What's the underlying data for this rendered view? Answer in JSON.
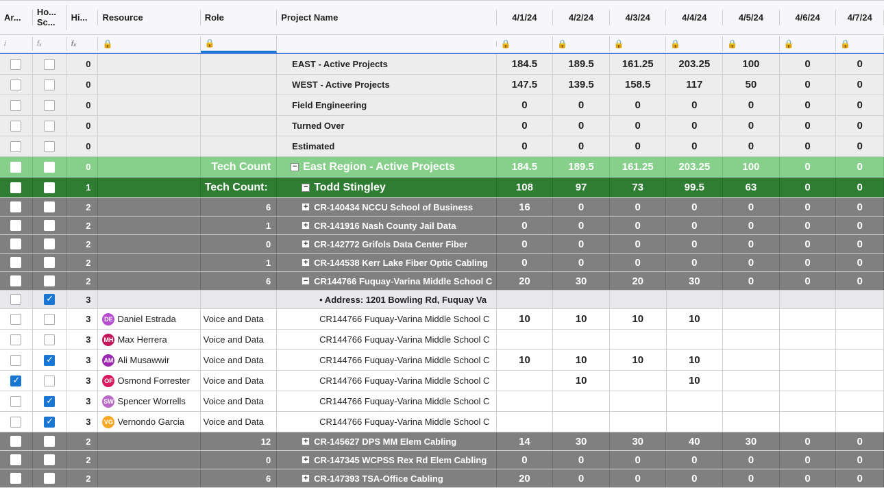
{
  "headers": {
    "ar": "Ar...",
    "ho": "Ho... Sc...",
    "hi": "Hi...",
    "resource": "Resource",
    "role": "Role",
    "project": "Project Name",
    "dates": [
      "4/1/24",
      "4/2/24",
      "4/3/24",
      "4/4/24",
      "4/5/24",
      "4/6/24",
      "4/7/24"
    ]
  },
  "subhdr": {
    "fx": "fₓ",
    "lock": "🔒",
    "i": "i"
  },
  "summary": [
    {
      "hi": "0",
      "name": "EAST - Active Projects",
      "vals": [
        "184.5",
        "189.5",
        "161.25",
        "203.25",
        "100",
        "0",
        "0"
      ]
    },
    {
      "hi": "0",
      "name": "WEST - Active Projects",
      "vals": [
        "147.5",
        "139.5",
        "158.5",
        "117",
        "50",
        "0",
        "0"
      ]
    },
    {
      "hi": "0",
      "name": "Field Engineering",
      "vals": [
        "0",
        "0",
        "0",
        "0",
        "0",
        "0",
        "0"
      ]
    },
    {
      "hi": "0",
      "name": "Turned Over",
      "vals": [
        "0",
        "0",
        "0",
        "0",
        "0",
        "0",
        "0"
      ]
    },
    {
      "hi": "0",
      "name": "Estimated",
      "vals": [
        "0",
        "0",
        "0",
        "0",
        "0",
        "0",
        "0"
      ]
    }
  ],
  "region": {
    "hi": "0",
    "role": "Tech Count",
    "name": "East Region - Active Projects",
    "toggle": "−",
    "vals": [
      "184.5",
      "189.5",
      "161.25",
      "203.25",
      "100",
      "0",
      "0"
    ]
  },
  "leader": {
    "hi": "1",
    "role": "Tech Count:",
    "name": "Todd Stingley",
    "toggle": "−",
    "vals": [
      "108",
      "97",
      "73",
      "99.5",
      "63",
      "0",
      "0"
    ]
  },
  "projectsA": [
    {
      "hi": "2",
      "role": "6",
      "toggle": "+",
      "name": "CR-140434 NCCU School of Business",
      "vals": [
        "16",
        "0",
        "0",
        "0",
        "0",
        "0",
        "0"
      ]
    },
    {
      "hi": "2",
      "role": "1",
      "toggle": "+",
      "name": "CR-141916 Nash County Jail Data",
      "vals": [
        "0",
        "0",
        "0",
        "0",
        "0",
        "0",
        "0"
      ]
    },
    {
      "hi": "2",
      "role": "0",
      "toggle": "+",
      "name": "CR-142772 Grifols Data Center Fiber",
      "vals": [
        "0",
        "0",
        "0",
        "0",
        "0",
        "0",
        "0"
      ]
    },
    {
      "hi": "2",
      "role": "1",
      "toggle": "+",
      "name": "CR-144538 Kerr Lake Fiber Optic Cabling",
      "vals": [
        "0",
        "0",
        "0",
        "0",
        "0",
        "0",
        "0"
      ]
    },
    {
      "hi": "2",
      "role": "6",
      "toggle": "−",
      "name": "CR144766 Fuquay-Varina Middle School C",
      "vals": [
        "20",
        "30",
        "20",
        "30",
        "0",
        "0",
        "0"
      ]
    }
  ],
  "address": {
    "hi": "3",
    "text": "• Address: 1201 Bowling Rd, Fuquay Va"
  },
  "details": [
    {
      "hi": "3",
      "ar": false,
      "ho": false,
      "avColor": "#b74fd0",
      "avInit": "DE",
      "res": "Daniel Estrada",
      "role": "Voice and Data",
      "proj": "CR144766 Fuquay-Varina Middle School C",
      "vals": [
        "10",
        "10",
        "10",
        "10",
        "",
        "",
        ""
      ]
    },
    {
      "hi": "3",
      "ar": false,
      "ho": false,
      "avColor": "#c2185b",
      "avInit": "MH",
      "res": "Max Herrera",
      "role": "Voice and Data",
      "proj": "CR144766 Fuquay-Varina Middle School C",
      "vals": [
        "",
        "",
        "",
        "",
        "",
        "",
        ""
      ]
    },
    {
      "hi": "3",
      "ar": false,
      "ho": true,
      "avColor": "#9c27b0",
      "avInit": "AM",
      "res": "Ali Musawwir",
      "role": "Voice and Data",
      "proj": "CR144766 Fuquay-Varina Middle School C",
      "vals": [
        "10",
        "10",
        "10",
        "10",
        "",
        "",
        ""
      ]
    },
    {
      "hi": "3",
      "ar": true,
      "ho": false,
      "avColor": "#d81b60",
      "avInit": "OF",
      "res": "Osmond Forrester",
      "role": "Voice and Data",
      "proj": "CR144766 Fuquay-Varina Middle School C",
      "vals": [
        "",
        "10",
        "",
        "10",
        "",
        "",
        ""
      ]
    },
    {
      "hi": "3",
      "ar": false,
      "ho": true,
      "avColor": "#ba68c8",
      "avInit": "SW",
      "res": "Spencer Worrells",
      "role": "Voice and Data",
      "proj": "CR144766 Fuquay-Varina Middle School C",
      "vals": [
        "",
        "",
        "",
        "",
        "",
        "",
        ""
      ]
    },
    {
      "hi": "3",
      "ar": false,
      "ho": true,
      "avColor": "#f9a825",
      "avInit": "VG",
      "res": "Vernondo Garcia",
      "role": "Voice and Data",
      "proj": "CR144766 Fuquay-Varina Middle School C",
      "vals": [
        "",
        "",
        "",
        "",
        "",
        "",
        ""
      ]
    }
  ],
  "projectsB": [
    {
      "hi": "2",
      "role": "12",
      "toggle": "+",
      "name": "CR-145627 DPS MM Elem Cabling",
      "vals": [
        "14",
        "30",
        "30",
        "40",
        "30",
        "0",
        "0"
      ]
    },
    {
      "hi": "2",
      "role": "0",
      "toggle": "+",
      "name": "CR-147345 WCPSS Rex Rd Elem Cabling",
      "vals": [
        "0",
        "0",
        "0",
        "0",
        "0",
        "0",
        "0"
      ]
    },
    {
      "hi": "2",
      "role": "6",
      "toggle": "+",
      "name": "CR-147393 TSA-Office Cabling",
      "vals": [
        "20",
        "0",
        "0",
        "0",
        "0",
        "0",
        "0"
      ]
    }
  ]
}
